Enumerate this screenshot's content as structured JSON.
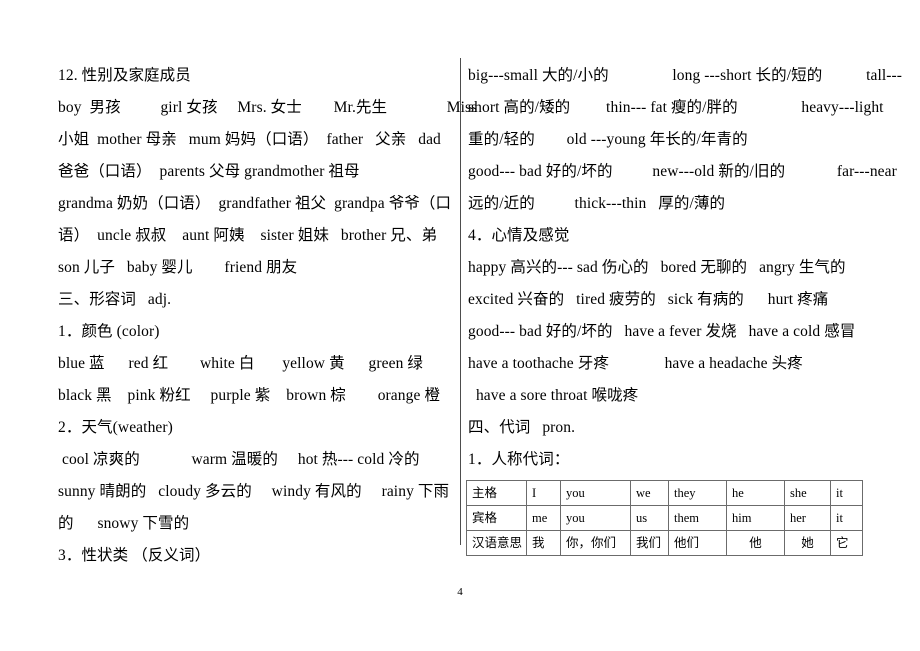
{
  "page": {
    "number": "4"
  },
  "left_column": {
    "lines": [
      "12. 性别及家庭成员",
      "boy  男孩          girl 女孩     Mrs. 女士        Mr.先生               Miss",
      "小姐  mother 母亲   mum 妈妈（口语）  father   父亲   dad",
      "爸爸（口语）  parents 父母 grandmother 祖母",
      "grandma 奶奶（口语）  grandfather 祖父  grandpa 爷爷（口",
      "语）  uncle 叔叔    aunt 阿姨    sister 姐妹   brother 兄、弟",
      "son 儿子   baby 婴儿        friend 朋友",
      "三、形容词   adj.",
      "1．颜色 (color)",
      "blue 蓝      red 红        white 白       yellow 黄      green 绿",
      "black 黑    pink 粉红     purple 紫    brown 棕        orange 橙",
      "2．天气(weather)",
      " cool 凉爽的             warm 温暖的     hot 热--- cold 冷的",
      "sunny 晴朗的   cloudy 多云的     windy 有风的     rainy 下雨",
      "的      snowy 下雪的",
      "3．性状类 （反义词）"
    ]
  },
  "right_column": {
    "lines": [
      "big---small 大的/小的                long ---short 长的/短的           tall---",
      "short 高的/矮的         thin--- fat 瘦的/胖的                heavy---light",
      "重的/轻的        old ---young 年长的/年青的",
      "good--- bad 好的/坏的          new---old 新的/旧的             far---near",
      "远的/近的          thick---thin   厚的/薄的",
      "4．心情及感觉",
      "happy 高兴的--- sad 伤心的   bored 无聊的   angry 生气的",
      "excited 兴奋的   tired 疲劳的   sick 有病的      hurt 疼痛",
      "good--- bad 好的/坏的   have a fever 发烧   have a cold 感冒",
      "have a toothache 牙疼              have a headache 头疼",
      "  have a sore throat 喉咙疼",
      "四、代词   pron.",
      "1．人称代词："
    ]
  },
  "pronoun_table": {
    "rows": [
      {
        "label": "主格",
        "cells": [
          "I",
          "you",
          "we",
          "they",
          "he",
          "she",
          "it"
        ]
      },
      {
        "label": "宾格",
        "cells": [
          "me",
          "you",
          "us",
          "them",
          "him",
          "her",
          "it"
        ]
      },
      {
        "label": "汉语意思",
        "cells": [
          "我",
          "你，你们",
          "我们",
          "他们",
          "他",
          "她",
          "它"
        ]
      }
    ]
  }
}
